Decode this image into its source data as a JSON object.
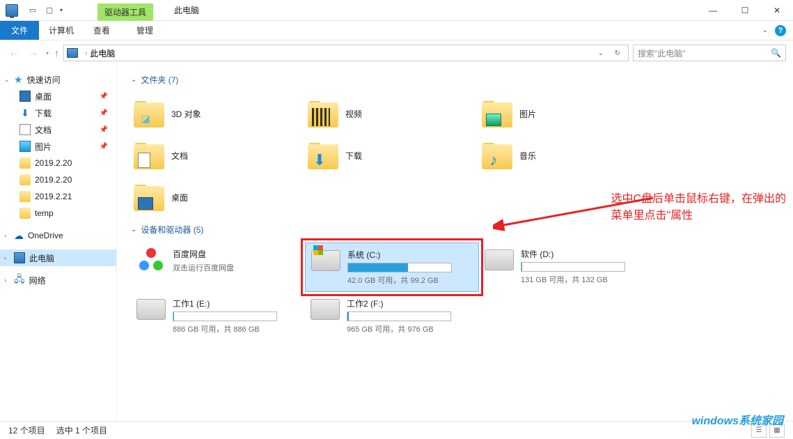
{
  "titlebar": {
    "driver_tool": "驱动器工具",
    "window_title": "此电脑"
  },
  "win": {
    "minimize": "—",
    "maximize": "☐",
    "close": "✕"
  },
  "ribbon": {
    "file": "文件",
    "computer": "计算机",
    "view": "查看",
    "manage": "管理"
  },
  "nav": {
    "location": "此电脑"
  },
  "search": {
    "placeholder": "搜索\"此电脑\""
  },
  "sidebar": {
    "quick": "快速访问",
    "desktop": "桌面",
    "downloads": "下载",
    "documents": "文档",
    "pictures": "图片",
    "f1": "2019.2.20",
    "f2": "2019.2.20",
    "f3": "2019.2.21",
    "f4": "temp",
    "onedrive": "OneDrive",
    "this_pc": "此电脑",
    "network": "网络"
  },
  "sections": {
    "folders": "文件夹 (7)",
    "devices": "设备和驱动器 (5)"
  },
  "folders": {
    "objects3d": "3D 对象",
    "video": "视频",
    "pictures": "图片",
    "documents": "文档",
    "downloads": "下载",
    "music": "音乐",
    "desktop": "桌面"
  },
  "devices": {
    "baidu": {
      "name": "百度网盘",
      "sub": "双击运行百度网盘"
    },
    "c": {
      "name": "系统 (C:)",
      "sub": "42.0 GB 可用，共 99.2 GB",
      "fill_pct": 58
    },
    "d": {
      "name": "软件 (D:)",
      "sub": "131 GB 可用，共 132 GB",
      "fill_pct": 1
    },
    "e": {
      "name": "工作1 (E:)",
      "sub": "886 GB 可用，共 886 GB",
      "fill_pct": 0.5
    },
    "f": {
      "name": "工作2 (F:)",
      "sub": "965 GB 可用，共 976 GB",
      "fill_pct": 1.5
    }
  },
  "annotation": {
    "line1": "选中C盘后单击鼠标右键，在弹出的",
    "line2": "菜单里点击\"属性"
  },
  "status": {
    "items": "12 个项目",
    "selected": "选中 1 个项目"
  },
  "watermark": "windows系统家园"
}
